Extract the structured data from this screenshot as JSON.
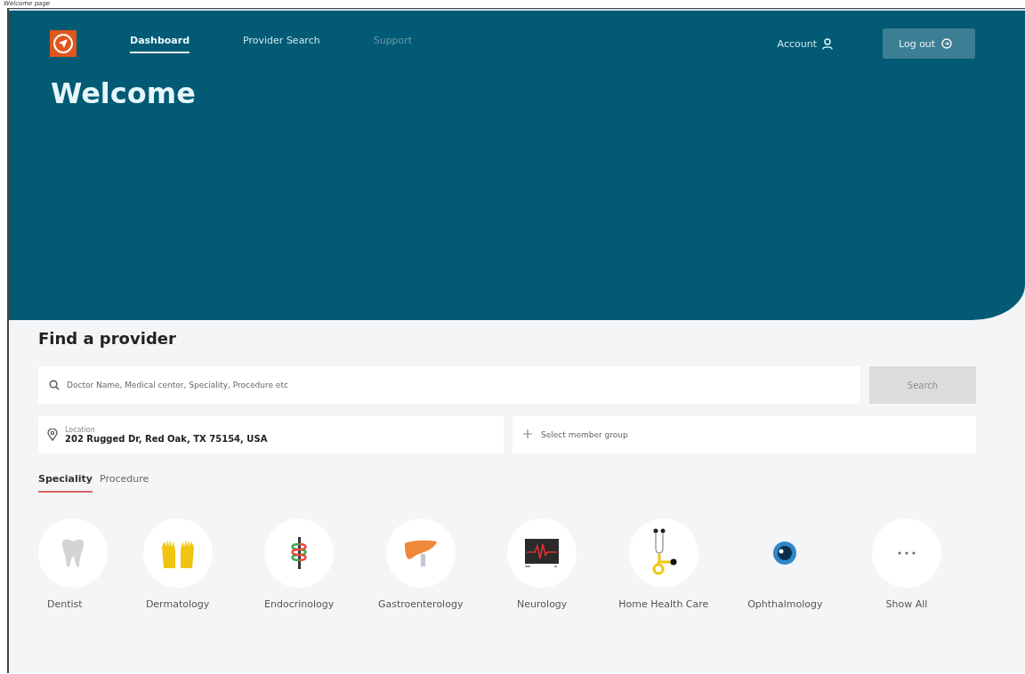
{
  "caption": "Welcome page",
  "nav": {
    "items": [
      {
        "label": "Dashboard",
        "selected": true,
        "disabled": false
      },
      {
        "label": "Provider Search",
        "selected": false,
        "disabled": false
      },
      {
        "label": "Support",
        "selected": false,
        "disabled": true
      }
    ],
    "account": "Account",
    "logout": "Log out"
  },
  "banner": {
    "title": "Welcome"
  },
  "find": {
    "title": "Find a provider",
    "search": {
      "placeholder": "Doctor Name, Medical center, Speciality, Procedure etc"
    },
    "search_button": {
      "label": "Search",
      "disabled": true
    },
    "location": {
      "label": "Location",
      "value": "202 Rugged Dr, Red Oak, TX 75154, USA"
    },
    "member_group": {
      "placeholder": "Select member group"
    }
  },
  "tabs": [
    {
      "label": "Speciality",
      "selected": true
    },
    {
      "label": "Procedure",
      "selected": false
    }
  ],
  "specialities": [
    {
      "label": "Dentist"
    },
    {
      "label": "Dermatology"
    },
    {
      "label": "Endocrinology"
    },
    {
      "label": "Gastroenterology"
    },
    {
      "label": "Neurology"
    },
    {
      "label": "Home Health Care"
    },
    {
      "label": "Ophthalmology"
    },
    {
      "label": "Show All"
    }
  ]
}
